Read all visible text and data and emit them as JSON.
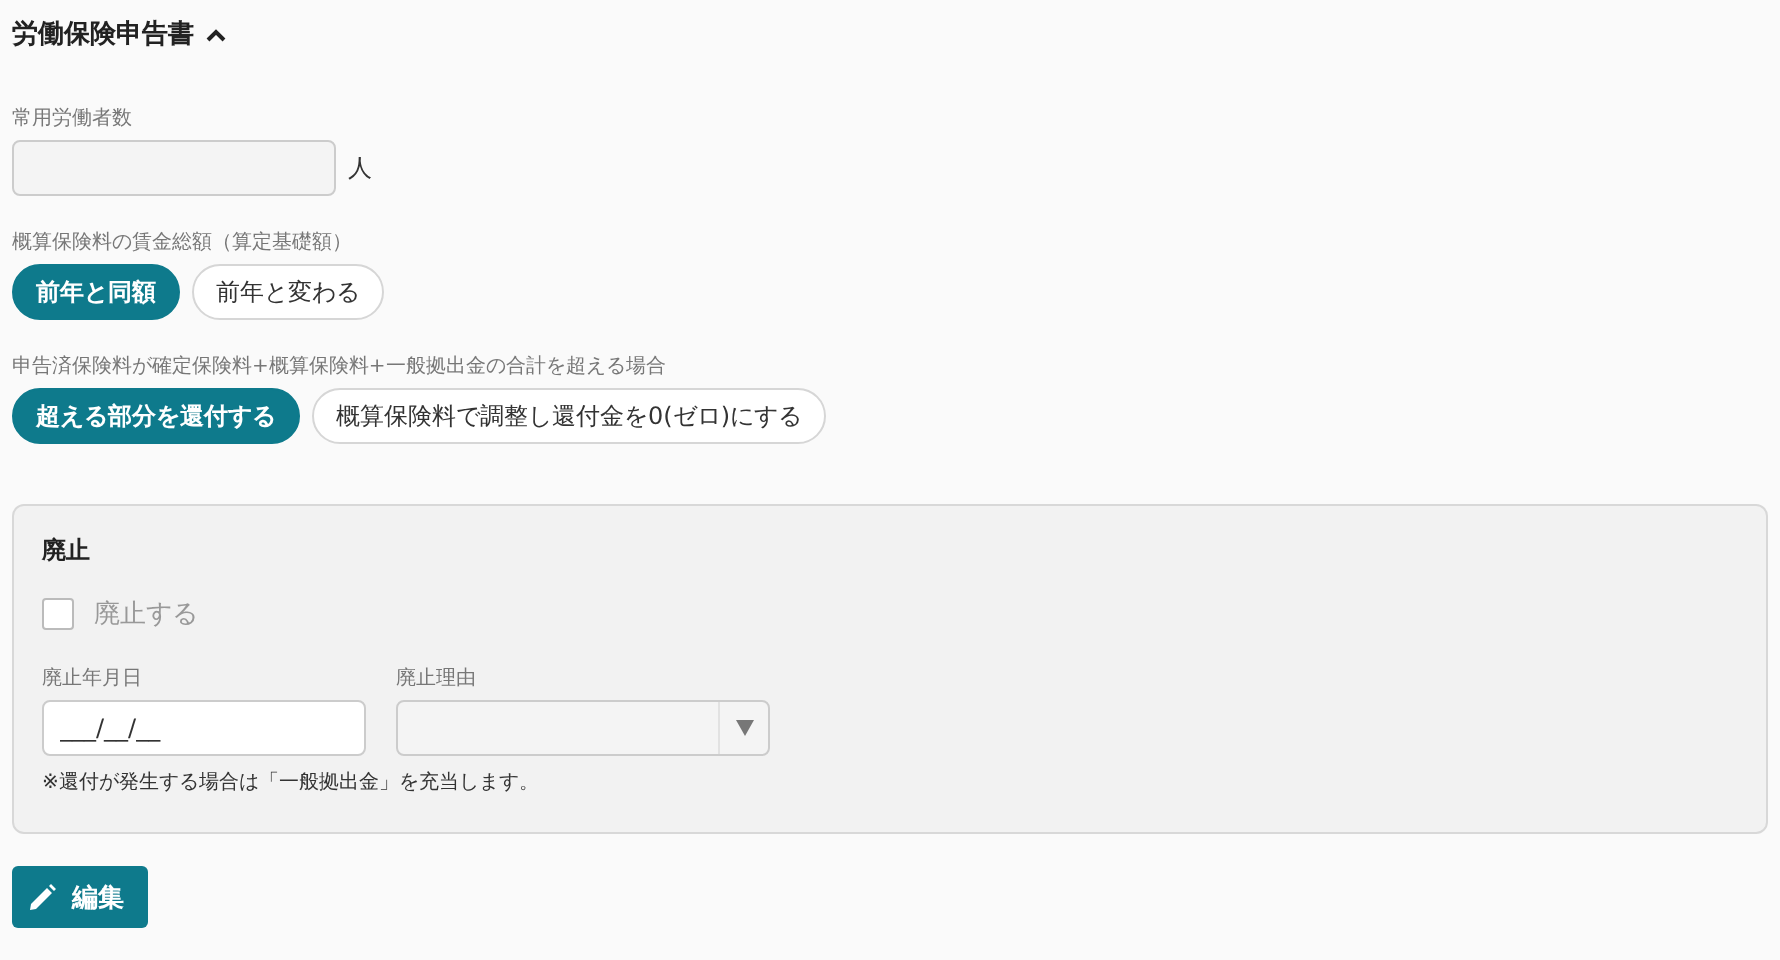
{
  "section": {
    "title": "労働保険申告書",
    "expanded": true
  },
  "workers": {
    "label": "常用労働者数",
    "unit": "人"
  },
  "groups": [
    {
      "label": "概算保険料の賃金総額（算定基礎額）",
      "options": [
        {
          "label": "前年と同額",
          "selected": true
        },
        {
          "label": "前年と変わる",
          "selected": false
        }
      ]
    },
    {
      "label": "申告済保険料が確定保険料+概算保険料+一般拠出金の合計を超える場合",
      "options": [
        {
          "label": "超える部分を還付する",
          "selected": true
        },
        {
          "label": "概算保険料で調整し還付金を0(ゼロ)にする",
          "selected": false
        }
      ]
    }
  ],
  "abolition": {
    "title": "廃止",
    "checkbox": {
      "label": "廃止する",
      "checked": false,
      "disabled": true
    },
    "date": {
      "label": "廃止年月日",
      "placeholder": "___/__/__"
    },
    "reason": {
      "label": "廃止理由"
    },
    "note": "※還付が発生する場合は「一般拠出金」を充当します。"
  },
  "edit_button": "編集"
}
